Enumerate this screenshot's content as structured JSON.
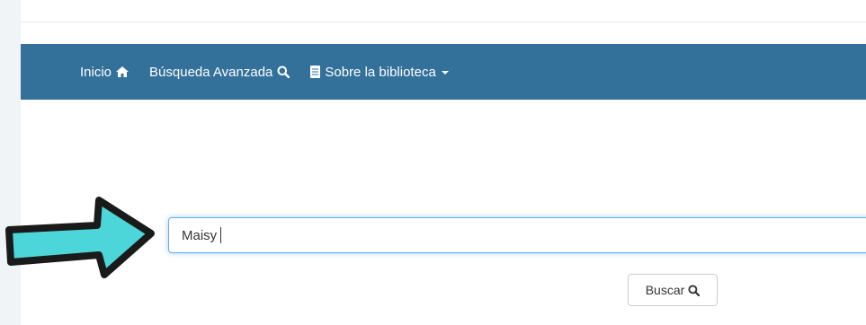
{
  "navbar": {
    "home_label": "Inicio",
    "home_icon": "home-icon",
    "advanced_label": "Búsqueda Avanzada",
    "advanced_icon": "search-icon",
    "about_label": "Sobre la biblioteca",
    "about_icon": "book-icon",
    "background": "#33709a"
  },
  "search": {
    "value": "Maisy",
    "button_label": "Buscar",
    "button_icon": "search-icon"
  },
  "annotation": {
    "arrow_color": "#4dd6d9"
  }
}
